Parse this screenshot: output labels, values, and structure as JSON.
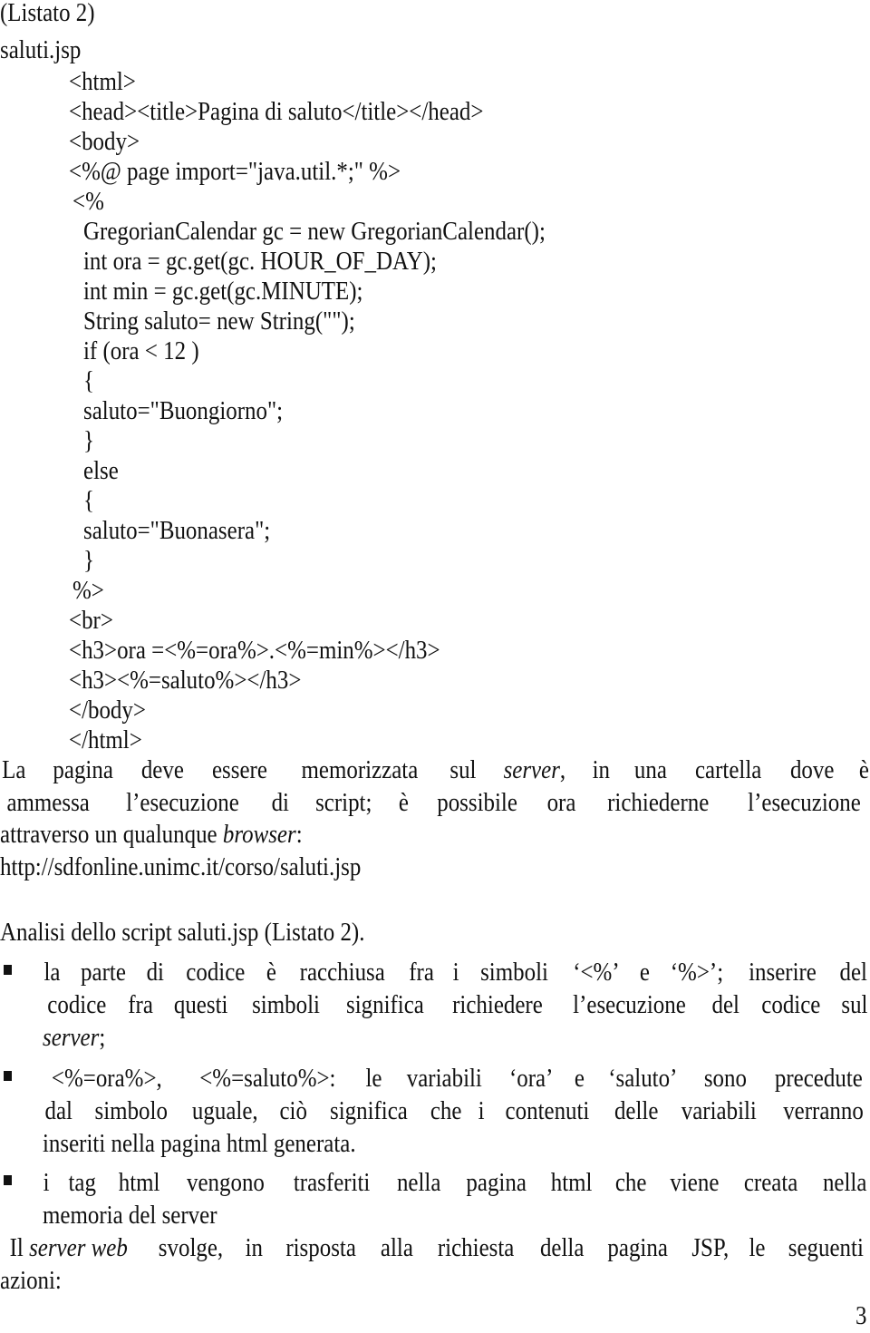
{
  "listing_label": "(Listato 2)",
  "filename": "saluti.jsp",
  "code_lines": [
    "<html>",
    "<head><title>Pagina di saluto</title></head>",
    "<body>",
    "<%@ page import=\"java.util.*;\" %>",
    "<%",
    "GregorianCalendar gc = new GregorianCalendar();",
    "int ora = gc.get(gc. HOUR_OF_DAY);",
    "int min = gc.get(gc.MINUTE);",
    "String saluto= new String(\"\");",
    "if  (ora < 12 )",
    "{",
    "saluto=\"Buongiorno\";",
    "}",
    "else",
    "{",
    "saluto=\"Buonasera\";",
    "}",
    "%>",
    "<br>",
    "<h3>ora =<%=ora%>.<%=min%></h3>",
    "<h3><%=saluto%></h3>",
    "</body>",
    "</html>"
  ],
  "paragraph1": {
    "line1": [
      "La",
      "pagina",
      "deve",
      "essere",
      "memorizzata",
      "sul",
      "server,",
      "in",
      "una",
      "cartella",
      "dove",
      "è"
    ],
    "line2": [
      "ammessa",
      "l’esecuzione",
      "di",
      "script;",
      "è",
      "possibile",
      "ora",
      "richiederne",
      "l’esecuzione"
    ],
    "line3_prefix": "attraverso un qualunque ",
    "line3_italic": "browser",
    "line3_suffix": ":",
    "url": "http://sdfonline.unimc.it/corso/saluti.jsp"
  },
  "analysis_heading": "Analisi dello script saluti.jsp (Listato 2).",
  "bullets": [
    {
      "lines": [
        [
          "la",
          "parte",
          "di",
          "codice",
          "è",
          "racchiusa",
          "fra",
          "i",
          "simboli",
          "‘<%’",
          "e",
          "‘%>’;",
          "inserire",
          "del"
        ],
        [
          "codice",
          "fra",
          "questi",
          "simboli",
          "significa",
          "richiedere",
          "l’esecuzione",
          "del",
          "codice",
          "sul"
        ]
      ],
      "last_italic": "server",
      "last_suffix": ";"
    },
    {
      "lines": [
        [
          "<%=ora%>,",
          "<%=saluto%>:",
          "le",
          "variabili",
          "‘ora’",
          "e",
          "‘saluto’",
          "sono",
          "precedute"
        ],
        [
          "dal",
          "simbolo",
          "uguale,",
          "ciò",
          "significa",
          "che",
          "i",
          "contenuti",
          "delle",
          "variabili",
          "verranno"
        ]
      ],
      "last_line": "inseriti nella pagina html generata."
    },
    {
      "lines": [
        [
          "i",
          "tag",
          "html",
          "vengono",
          "trasferiti",
          "nella",
          "pagina",
          "html",
          "che",
          "viene",
          "creata",
          "nella"
        ]
      ],
      "last_line": "memoria del server"
    }
  ],
  "closing": {
    "prefix": "Il ",
    "italic": "server web",
    "words_after": [
      "svolge,",
      "in",
      "risposta",
      "alla",
      "richiesta",
      "della",
      "pagina",
      "JSP,",
      "le",
      "seguenti"
    ],
    "last_line": "azioni:"
  },
  "page_number": "3"
}
